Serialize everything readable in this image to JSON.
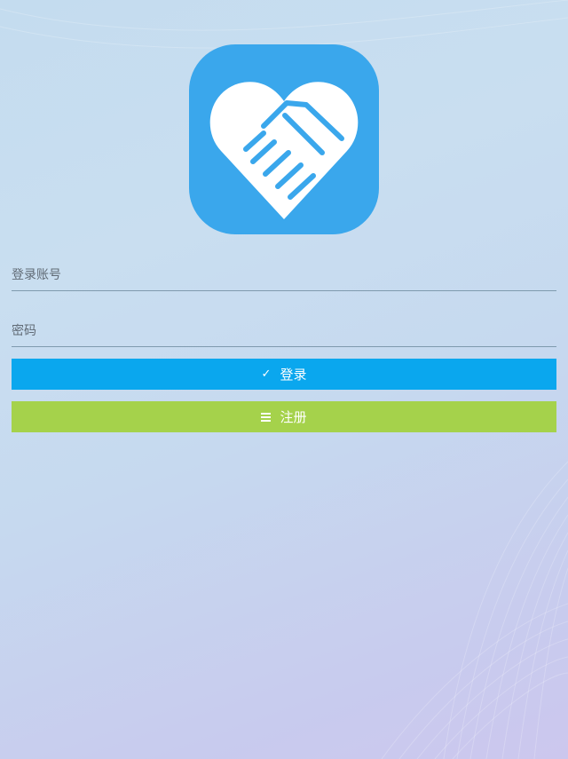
{
  "app": {
    "logo_icon": "heart-handshake-icon",
    "brand_color": "#3aa7ec"
  },
  "form": {
    "account_placeholder": "登录账号",
    "password_placeholder": "密码"
  },
  "buttons": {
    "login_label": "登录",
    "login_icon": "check-icon",
    "login_color": "#0aa7ee",
    "register_label": "注册",
    "register_icon": "menu-lines-icon",
    "register_color": "#a5d24b"
  }
}
